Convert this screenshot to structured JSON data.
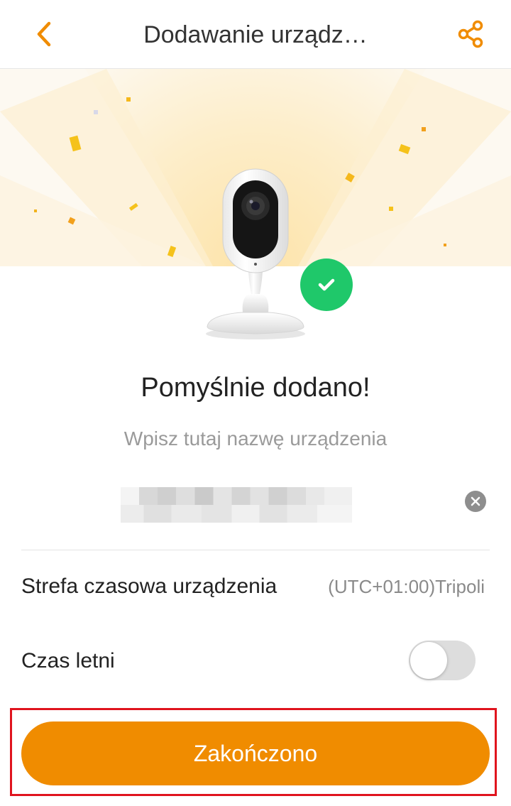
{
  "header": {
    "title": "Dodawanie urządz…",
    "back_icon": "chevron-left-icon",
    "share_icon": "share-icon"
  },
  "hero": {
    "device_image": "wifi-camera",
    "status_icon": "checkmark-icon"
  },
  "success": {
    "title": "Pomyślnie dodano!",
    "name_hint": "Wpisz tutaj nazwę urządzenia"
  },
  "name_field": {
    "value": "",
    "clear_icon": "clear-icon"
  },
  "settings": {
    "timezone_label": "Strefa czasowa urządzenia",
    "timezone_value": "(UTC+01:00)Tripoli",
    "dst_label": "Czas letni",
    "dst_enabled": false
  },
  "actions": {
    "finish_label": "Zakończono"
  },
  "colors": {
    "accent": "#f08c00",
    "success": "#1fc86a",
    "highlight": "#e0141e"
  }
}
